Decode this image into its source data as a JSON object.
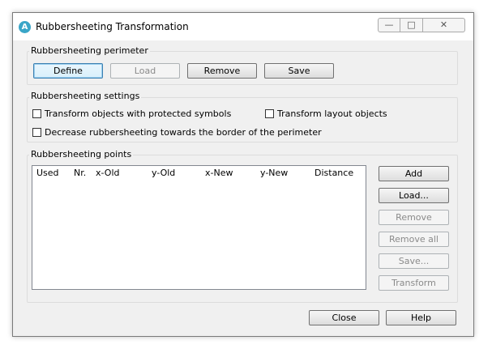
{
  "window": {
    "title": "Rubbersheeting Transformation",
    "icon_letter": "A",
    "controls": {
      "minimize": "—",
      "maximize": "□",
      "close": "✕"
    }
  },
  "perimeter": {
    "label": "Rubbersheeting perimeter",
    "define": "Define",
    "load": "Load",
    "remove": "Remove",
    "save": "Save"
  },
  "settings": {
    "label": "Rubbersheeting settings",
    "protected_symbols": "Transform objects with protected symbols",
    "layout_objects": "Transform layout objects",
    "decrease_border": "Decrease rubbersheeting towards the border of the perimeter"
  },
  "points": {
    "label": "Rubbersheeting points",
    "columns": [
      "Used",
      "Nr.",
      "x-Old",
      "y-Old",
      "x-New",
      "y-New",
      "Distance"
    ],
    "add": "Add",
    "load": "Load...",
    "remove": "Remove",
    "remove_all": "Remove all",
    "save": "Save...",
    "transform": "Transform"
  },
  "footer": {
    "close": "Close",
    "help": "Help"
  }
}
